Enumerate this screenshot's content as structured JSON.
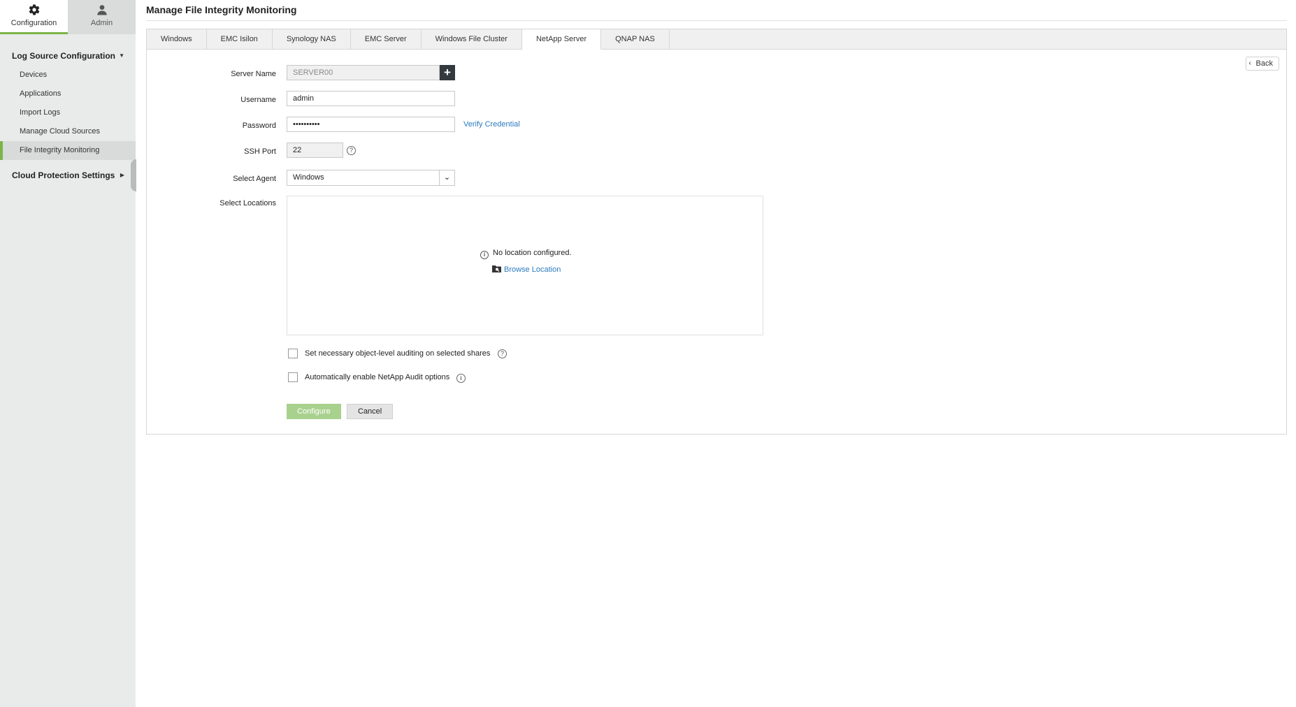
{
  "topnav": {
    "configuration_label": "Configuration",
    "admin_label": "Admin"
  },
  "sidebar": {
    "section1_title": "Log Source Configuration",
    "items": [
      {
        "label": "Devices"
      },
      {
        "label": "Applications"
      },
      {
        "label": "Import Logs"
      },
      {
        "label": "Manage Cloud Sources"
      },
      {
        "label": "File Integrity Monitoring"
      }
    ],
    "section2_title": "Cloud Protection Settings"
  },
  "page": {
    "title": "Manage File Integrity Monitoring",
    "back_label": "Back"
  },
  "tabs": [
    {
      "label": "Windows"
    },
    {
      "label": "EMC Isilon"
    },
    {
      "label": "Synology NAS"
    },
    {
      "label": "EMC Server"
    },
    {
      "label": "Windows File Cluster"
    },
    {
      "label": "NetApp Server"
    },
    {
      "label": "QNAP NAS"
    }
  ],
  "active_tab": "NetApp Server",
  "form": {
    "server_name_label": "Server Name",
    "server_name_placeholder": "SERVER00",
    "username_label": "Username",
    "username_value": "admin",
    "password_label": "Password",
    "password_value": "••••••••••",
    "verify_label": "Verify Credential",
    "ssh_port_label": "SSH Port",
    "ssh_port_value": "22",
    "select_agent_label": "Select Agent",
    "select_agent_value": "Windows",
    "select_locations_label": "Select Locations",
    "no_location_msg": "No location configured.",
    "browse_location_label": "Browse Location",
    "checkbox_audit_label": "Set necessary object-level auditing on selected shares",
    "checkbox_netapp_label": "Automatically enable NetApp Audit options",
    "configure_label": "Configure",
    "cancel_label": "Cancel"
  },
  "colors": {
    "accent": "#7bb54a",
    "link": "#2b7bbf",
    "primary_button": "#a9d18e"
  }
}
